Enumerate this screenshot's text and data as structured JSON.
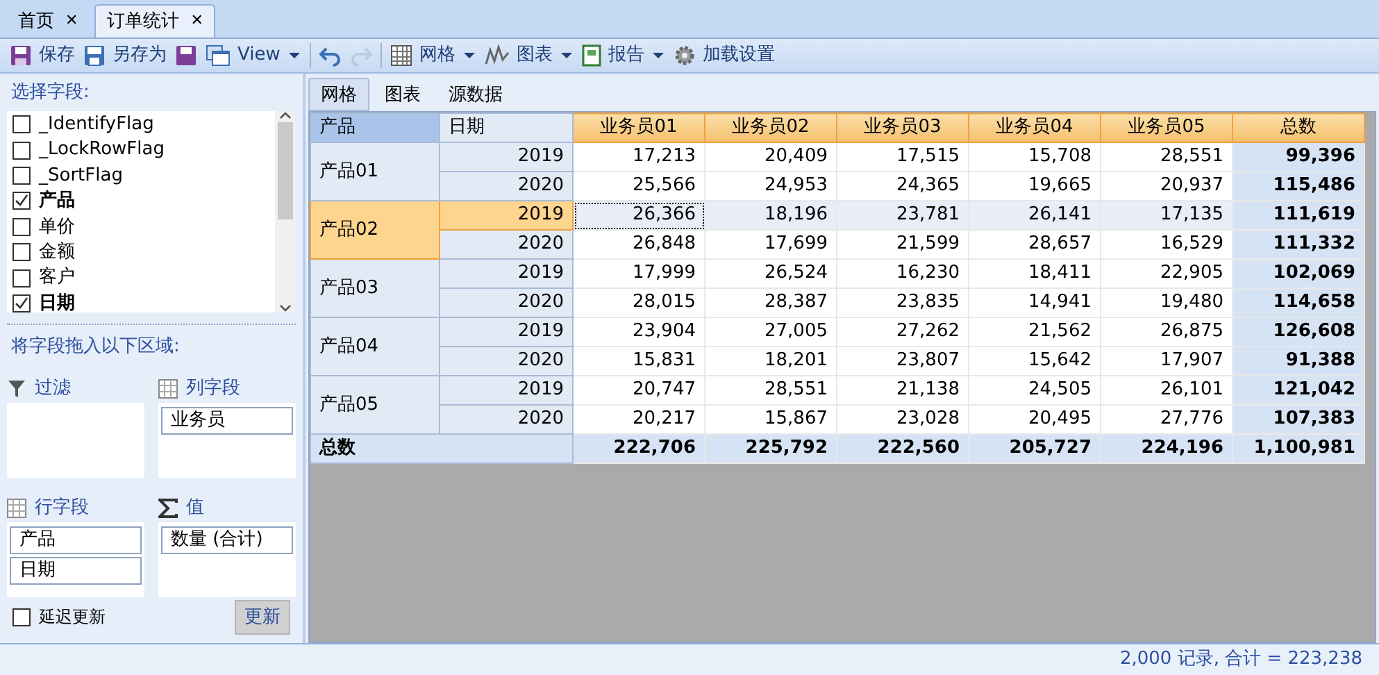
{
  "doc_tabs": [
    {
      "label": "首页",
      "selected": false,
      "close": "✕"
    },
    {
      "label": "订单统计",
      "selected": true,
      "close": "✕"
    }
  ],
  "toolbar": [
    {
      "kind": "save",
      "label": "保存",
      "disabled": false,
      "menu": false
    },
    {
      "kind": "saveas",
      "label": "另存为",
      "disabled": false,
      "menu": false
    },
    {
      "kind": "floppy",
      "disabled": false,
      "menu": false
    },
    {
      "kind": "windows",
      "label": "View",
      "disabled": false,
      "menu": true
    },
    {
      "kind": "separator"
    },
    {
      "kind": "undo",
      "disabled": false,
      "menu": false
    },
    {
      "kind": "redo",
      "disabled": true,
      "menu": false
    },
    {
      "kind": "separator"
    },
    {
      "kind": "grid",
      "label": "网格",
      "disabled": false,
      "menu": true
    },
    {
      "kind": "chart",
      "label": "图表",
      "disabled": false,
      "menu": true
    },
    {
      "kind": "report",
      "label": "报告",
      "disabled": false,
      "menu": true
    },
    {
      "kind": "gear",
      "label": "加载设置",
      "disabled": false,
      "menu": false
    }
  ],
  "field_panel": {
    "title": "选择字段:",
    "fields": [
      {
        "label": "_IdentifyFlag",
        "checked": false
      },
      {
        "label": "_LockRowFlag",
        "checked": false
      },
      {
        "label": "_SortFlag",
        "checked": false
      },
      {
        "label": "产品",
        "checked": true
      },
      {
        "label": "单价",
        "checked": false
      },
      {
        "label": "金额",
        "checked": false
      },
      {
        "label": "客户",
        "checked": false
      },
      {
        "label": "日期",
        "checked": true
      }
    ],
    "drop_hint": "将字段拖入以下区域:",
    "zones": [
      {
        "kind": "filter",
        "title": "过滤"
      },
      {
        "kind": "columns",
        "title": "列字段",
        "items": [
          "业务员"
        ]
      },
      {
        "kind": "rows",
        "title": "行字段",
        "items": [
          "产品",
          "日期"
        ]
      },
      {
        "kind": "values",
        "title": "值",
        "items": [
          "数量 (合计)"
        ]
      }
    ],
    "defer_update": {
      "label": "延迟更新",
      "checked": false
    },
    "update_button": "更新"
  },
  "view_tabs": [
    {
      "label": "网格",
      "selected": true
    },
    {
      "label": "图表",
      "selected": false
    },
    {
      "label": "源数据",
      "selected": false
    }
  ],
  "pivot": {
    "row_headers": [
      {
        "label": "产品",
        "selected": true
      },
      {
        "label": "日期",
        "selected": false
      }
    ],
    "columns": [
      "业务员01",
      "业务员02",
      "业务员03",
      "业务员04",
      "业务员05",
      "总数"
    ],
    "groups": [
      {
        "label": "产品01",
        "selected": false,
        "rows": [
          {
            "year": "2019",
            "selected": false,
            "cells": [
              {
                "value": "17,213",
                "focused": false
              },
              {
                "value": "20,409",
                "focused": false
              },
              {
                "value": "17,515",
                "focused": false
              },
              {
                "value": "15,708",
                "focused": false
              },
              {
                "value": "28,551",
                "focused": false
              }
            ],
            "total": "99,396"
          },
          {
            "year": "2020",
            "selected": false,
            "cells": [
              {
                "value": "25,566",
                "focused": false
              },
              {
                "value": "24,953",
                "focused": false
              },
              {
                "value": "24,365",
                "focused": false
              },
              {
                "value": "19,665",
                "focused": false
              },
              {
                "value": "20,937",
                "focused": false
              }
            ],
            "total": "115,486"
          }
        ]
      },
      {
        "label": "产品02",
        "selected": true,
        "rows": [
          {
            "year": "2019",
            "selected": true,
            "cells": [
              {
                "value": "26,366",
                "focused": true
              },
              {
                "value": "18,196",
                "focused": false
              },
              {
                "value": "23,781",
                "focused": false
              },
              {
                "value": "26,141",
                "focused": false
              },
              {
                "value": "17,135",
                "focused": false
              }
            ],
            "total": "111,619"
          },
          {
            "year": "2020",
            "selected": false,
            "cells": [
              {
                "value": "26,848",
                "focused": false
              },
              {
                "value": "17,699",
                "focused": false
              },
              {
                "value": "21,599",
                "focused": false
              },
              {
                "value": "28,657",
                "focused": false
              },
              {
                "value": "16,529",
                "focused": false
              }
            ],
            "total": "111,332"
          }
        ]
      },
      {
        "label": "产品03",
        "selected": false,
        "rows": [
          {
            "year": "2019",
            "selected": false,
            "cells": [
              {
                "value": "17,999",
                "focused": false
              },
              {
                "value": "26,524",
                "focused": false
              },
              {
                "value": "16,230",
                "focused": false
              },
              {
                "value": "18,411",
                "focused": false
              },
              {
                "value": "22,905",
                "focused": false
              }
            ],
            "total": "102,069"
          },
          {
            "year": "2020",
            "selected": false,
            "cells": [
              {
                "value": "28,015",
                "focused": false
              },
              {
                "value": "28,387",
                "focused": false
              },
              {
                "value": "23,835",
                "focused": false
              },
              {
                "value": "14,941",
                "focused": false
              },
              {
                "value": "19,480",
                "focused": false
              }
            ],
            "total": "114,658"
          }
        ]
      },
      {
        "label": "产品04",
        "selected": false,
        "rows": [
          {
            "year": "2019",
            "selected": false,
            "cells": [
              {
                "value": "23,904",
                "focused": false
              },
              {
                "value": "27,005",
                "focused": false
              },
              {
                "value": "27,262",
                "focused": false
              },
              {
                "value": "21,562",
                "focused": false
              },
              {
                "value": "26,875",
                "focused": false
              }
            ],
            "total": "126,608"
          },
          {
            "year": "2020",
            "selected": false,
            "cells": [
              {
                "value": "15,831",
                "focused": false
              },
              {
                "value": "18,201",
                "focused": false
              },
              {
                "value": "23,807",
                "focused": false
              },
              {
                "value": "15,642",
                "focused": false
              },
              {
                "value": "17,907",
                "focused": false
              }
            ],
            "total": "91,388"
          }
        ]
      },
      {
        "label": "产品05",
        "selected": false,
        "rows": [
          {
            "year": "2019",
            "selected": false,
            "cells": [
              {
                "value": "20,747",
                "focused": false
              },
              {
                "value": "28,551",
                "focused": false
              },
              {
                "value": "21,138",
                "focused": false
              },
              {
                "value": "24,505",
                "focused": false
              },
              {
                "value": "26,101",
                "focused": false
              }
            ],
            "total": "121,042"
          },
          {
            "year": "2020",
            "selected": false,
            "cells": [
              {
                "value": "20,217",
                "focused": false
              },
              {
                "value": "15,867",
                "focused": false
              },
              {
                "value": "23,028",
                "focused": false
              },
              {
                "value": "20,495",
                "focused": false
              },
              {
                "value": "27,776",
                "focused": false
              }
            ],
            "total": "107,383"
          }
        ]
      }
    ],
    "totals_label": "总数",
    "totals": [
      "222,706",
      "225,792",
      "222,560",
      "205,727",
      "224,196",
      "1,100,981"
    ]
  },
  "status_bar": "2,000 记录, 合计 = 223,238"
}
